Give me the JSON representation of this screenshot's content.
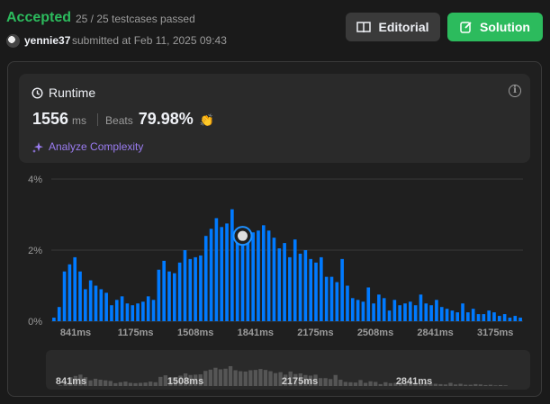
{
  "header": {
    "status": "Accepted",
    "cases": "25 / 25 testcases passed",
    "user": "yennie37",
    "submitted": "submitted at Feb 11, 2025 09:43",
    "editorial_label": "Editorial",
    "solution_label": "Solution"
  },
  "runtime": {
    "title": "Runtime",
    "value": "1556",
    "unit": "ms",
    "beats_label": "Beats",
    "beats_value": "79.98%",
    "analyze_label": "Analyze Complexity"
  },
  "colors": {
    "accent": "#2cbb5d",
    "bar": "#007aff",
    "mini_bar": "#555555"
  },
  "chart_data": {
    "type": "bar",
    "y_ticks": [
      "4%",
      "2%",
      "0%"
    ],
    "ylim": [
      0,
      4
    ],
    "x_tick_labels": [
      "841ms",
      "1175ms",
      "1508ms",
      "1841ms",
      "2175ms",
      "2508ms",
      "2841ms",
      "3175ms"
    ],
    "mini_tick_labels": [
      "841ms",
      "1508ms",
      "2175ms",
      "2841ms"
    ],
    "marker_index": 36,
    "values": [
      0.1,
      0.4,
      1.4,
      1.6,
      1.8,
      1.4,
      0.9,
      1.15,
      1.0,
      0.9,
      0.8,
      0.45,
      0.6,
      0.7,
      0.5,
      0.45,
      0.5,
      0.55,
      0.7,
      0.6,
      1.45,
      1.7,
      1.4,
      1.35,
      1.65,
      2.0,
      1.75,
      1.8,
      1.85,
      2.4,
      2.6,
      2.9,
      2.65,
      2.75,
      3.15,
      2.5,
      2.35,
      2.3,
      2.5,
      2.55,
      2.7,
      2.55,
      2.35,
      2.05,
      2.2,
      1.8,
      2.3,
      1.9,
      2.0,
      1.75,
      1.65,
      1.8,
      1.25,
      1.25,
      1.1,
      1.75,
      1.0,
      0.65,
      0.6,
      0.55,
      0.95,
      0.5,
      0.75,
      0.65,
      0.3,
      0.6,
      0.45,
      0.5,
      0.55,
      0.45,
      0.75,
      0.5,
      0.45,
      0.6,
      0.4,
      0.35,
      0.3,
      0.25,
      0.5,
      0.25,
      0.35,
      0.2,
      0.2,
      0.3,
      0.25,
      0.15,
      0.2,
      0.1,
      0.15,
      0.1
    ]
  }
}
